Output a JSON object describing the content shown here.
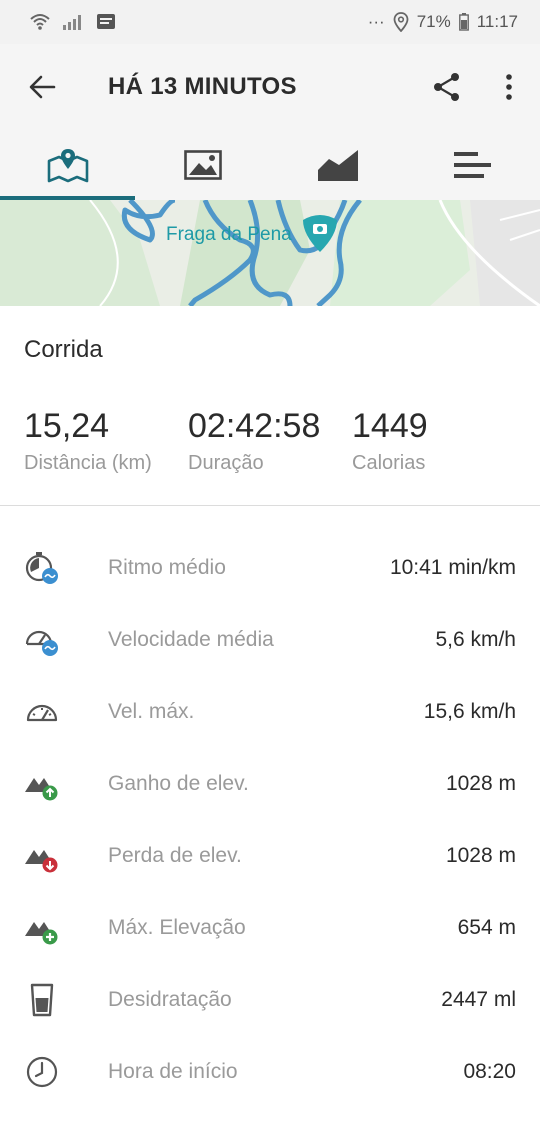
{
  "status_bar": {
    "battery": "71%",
    "time": "11:17",
    "dots": "···"
  },
  "app_bar": {
    "title": "HÁ 13 MINUTOS"
  },
  "tabs": [
    {
      "icon": "map-pin-icon",
      "active": true
    },
    {
      "icon": "image-icon",
      "active": false
    },
    {
      "icon": "chart-icon",
      "active": false
    },
    {
      "icon": "list-icon",
      "active": false
    }
  ],
  "map": {
    "place_label": "Fraga da Pena"
  },
  "activity": {
    "type": "Corrida"
  },
  "summary": [
    {
      "value": "15,24",
      "label": "Distância (km)"
    },
    {
      "value": "02:42:58",
      "label": "Duração"
    },
    {
      "value": "1449",
      "label": "Calorias"
    }
  ],
  "stats": [
    {
      "icon": "avg-pace-icon",
      "label": "Ritmo médio",
      "value": "10:41 min/km"
    },
    {
      "icon": "avg-speed-icon",
      "label": "Velocidade média",
      "value": "5,6 km/h"
    },
    {
      "icon": "max-speed-icon",
      "label": "Vel. máx.",
      "value": "15,6 km/h"
    },
    {
      "icon": "elevation-gain-icon",
      "label": "Ganho de elev.",
      "value": "1028 m"
    },
    {
      "icon": "elevation-loss-icon",
      "label": "Perda de elev.",
      "value": "1028 m"
    },
    {
      "icon": "max-elevation-icon",
      "label": "Máx. Elevação",
      "value": "654 m"
    },
    {
      "icon": "dehydration-icon",
      "label": "Desidratação",
      "value": "2447 ml"
    },
    {
      "icon": "start-time-icon",
      "label": "Hora de início",
      "value": "08:20"
    }
  ],
  "colors": {
    "accent": "#1b6d7c",
    "route": "#4f97c9",
    "gain": "#3a9a4a",
    "loss": "#c9303a"
  }
}
